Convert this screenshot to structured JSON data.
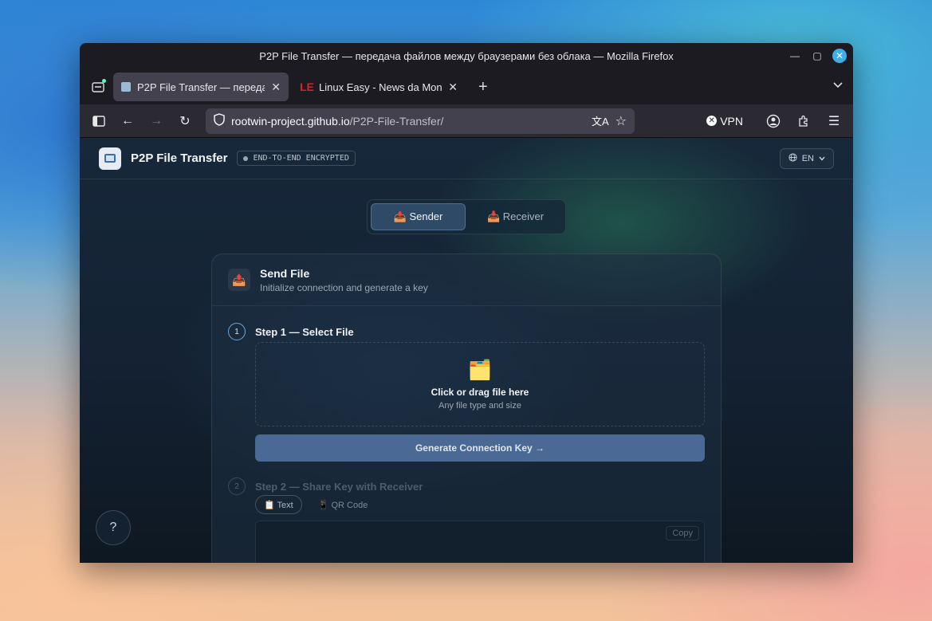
{
  "window": {
    "title": "P2P File Transfer — передача файлов между браузерами без облака — Mozilla Firefox"
  },
  "tabs": [
    {
      "label": "P2P File Transfer — передача файлов",
      "close": "✕"
    },
    {
      "label": "Linux Easy - News da Mondo Linux",
      "close": "✕",
      "favicon": "LE"
    }
  ],
  "tabbar": {
    "new_tab": "+",
    "overflow": "⌄"
  },
  "url": {
    "host": "rootwin-project.github.io",
    "path": "/P2P-File-Transfer/"
  },
  "toolbar": {
    "vpn_label": "VPN"
  },
  "app": {
    "title": "P2P File Transfer",
    "badge": "END-TO-END ENCRYPTED",
    "lang": "EN"
  },
  "roles": {
    "sender": "📤 Sender",
    "receiver": "📥 Receiver"
  },
  "card": {
    "icon": "📤",
    "title": "Send File",
    "subtitle": "Initialize connection and generate a key"
  },
  "step1": {
    "num": "1",
    "label": "Step 1 — Select File"
  },
  "dropzone": {
    "icon": "🗂️",
    "title": "Click or drag file here",
    "subtitle": "Any file type and size"
  },
  "generate_button": "Generate Connection Key →",
  "step2": {
    "num": "2",
    "label": "Step 2 — Share Key with Receiver"
  },
  "mode_tabs": {
    "text": "📋 Text",
    "qr": "📱 QR Code"
  },
  "copy_button": "Copy",
  "help_button": "?"
}
